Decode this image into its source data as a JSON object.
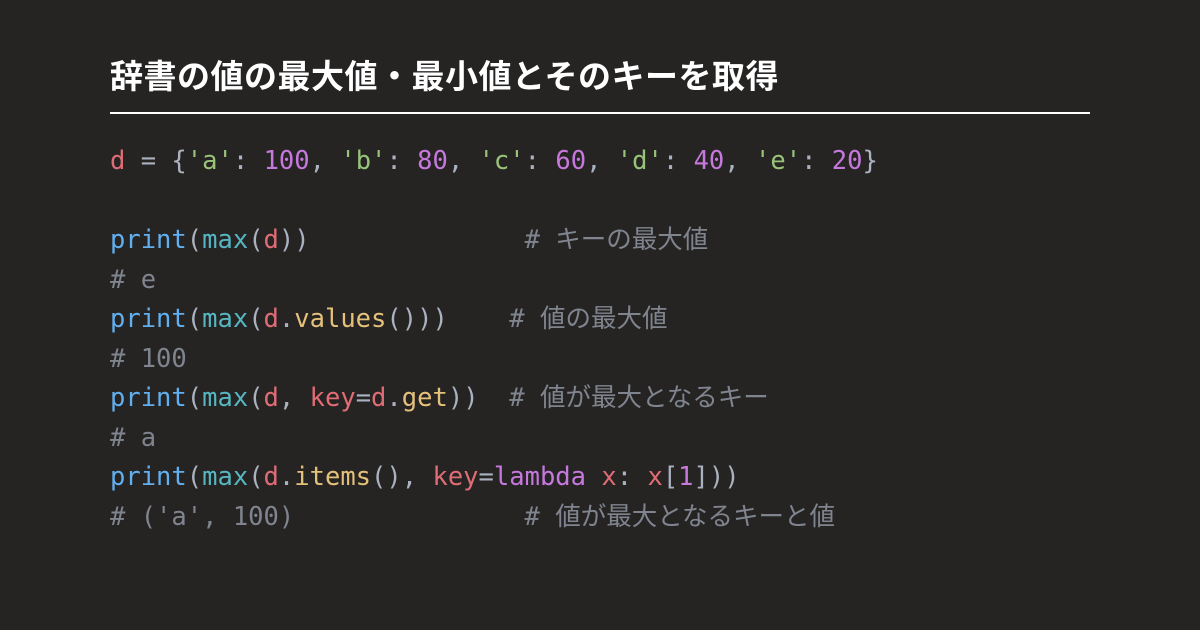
{
  "title": "辞書の値の最大値・最小値とそのキーを取得",
  "code": {
    "dict": {
      "var": "d",
      "assign": " = ",
      "lbrace": "{",
      "rbrace": "}",
      "colon": ": ",
      "comma": ", ",
      "k1": "'a'",
      "v1": "100",
      "k2": "'b'",
      "v2": "80",
      "k3": "'c'",
      "v3": "60",
      "k4": "'d'",
      "v4": "40",
      "k5": "'e'",
      "v5": "20"
    },
    "print": "print",
    "max": "max",
    "lparen": "(",
    "rparen": ")",
    "d": "d",
    "dot": ".",
    "values": "values",
    "items": "items",
    "get": "get",
    "comma_sp": ", ",
    "key_eq": "key",
    "eq": "=",
    "lambda": "lambda",
    "x": "x",
    "colon_sp": ": ",
    "lbracket": "[",
    "rbracket": "]",
    "one": "1",
    "c1_pad": "              ",
    "c1": "# キーの最大値",
    "out1": "# e",
    "c2_pad": "    ",
    "c2": "# 値の最大値",
    "out2": "# 100",
    "c3_pad": "  ",
    "c3": "# 値が最大となるキー",
    "out3": "# a",
    "out4": "# ('a', 100)",
    "c4_pad": "               ",
    "c4": "# 値が最大となるキーと値"
  }
}
